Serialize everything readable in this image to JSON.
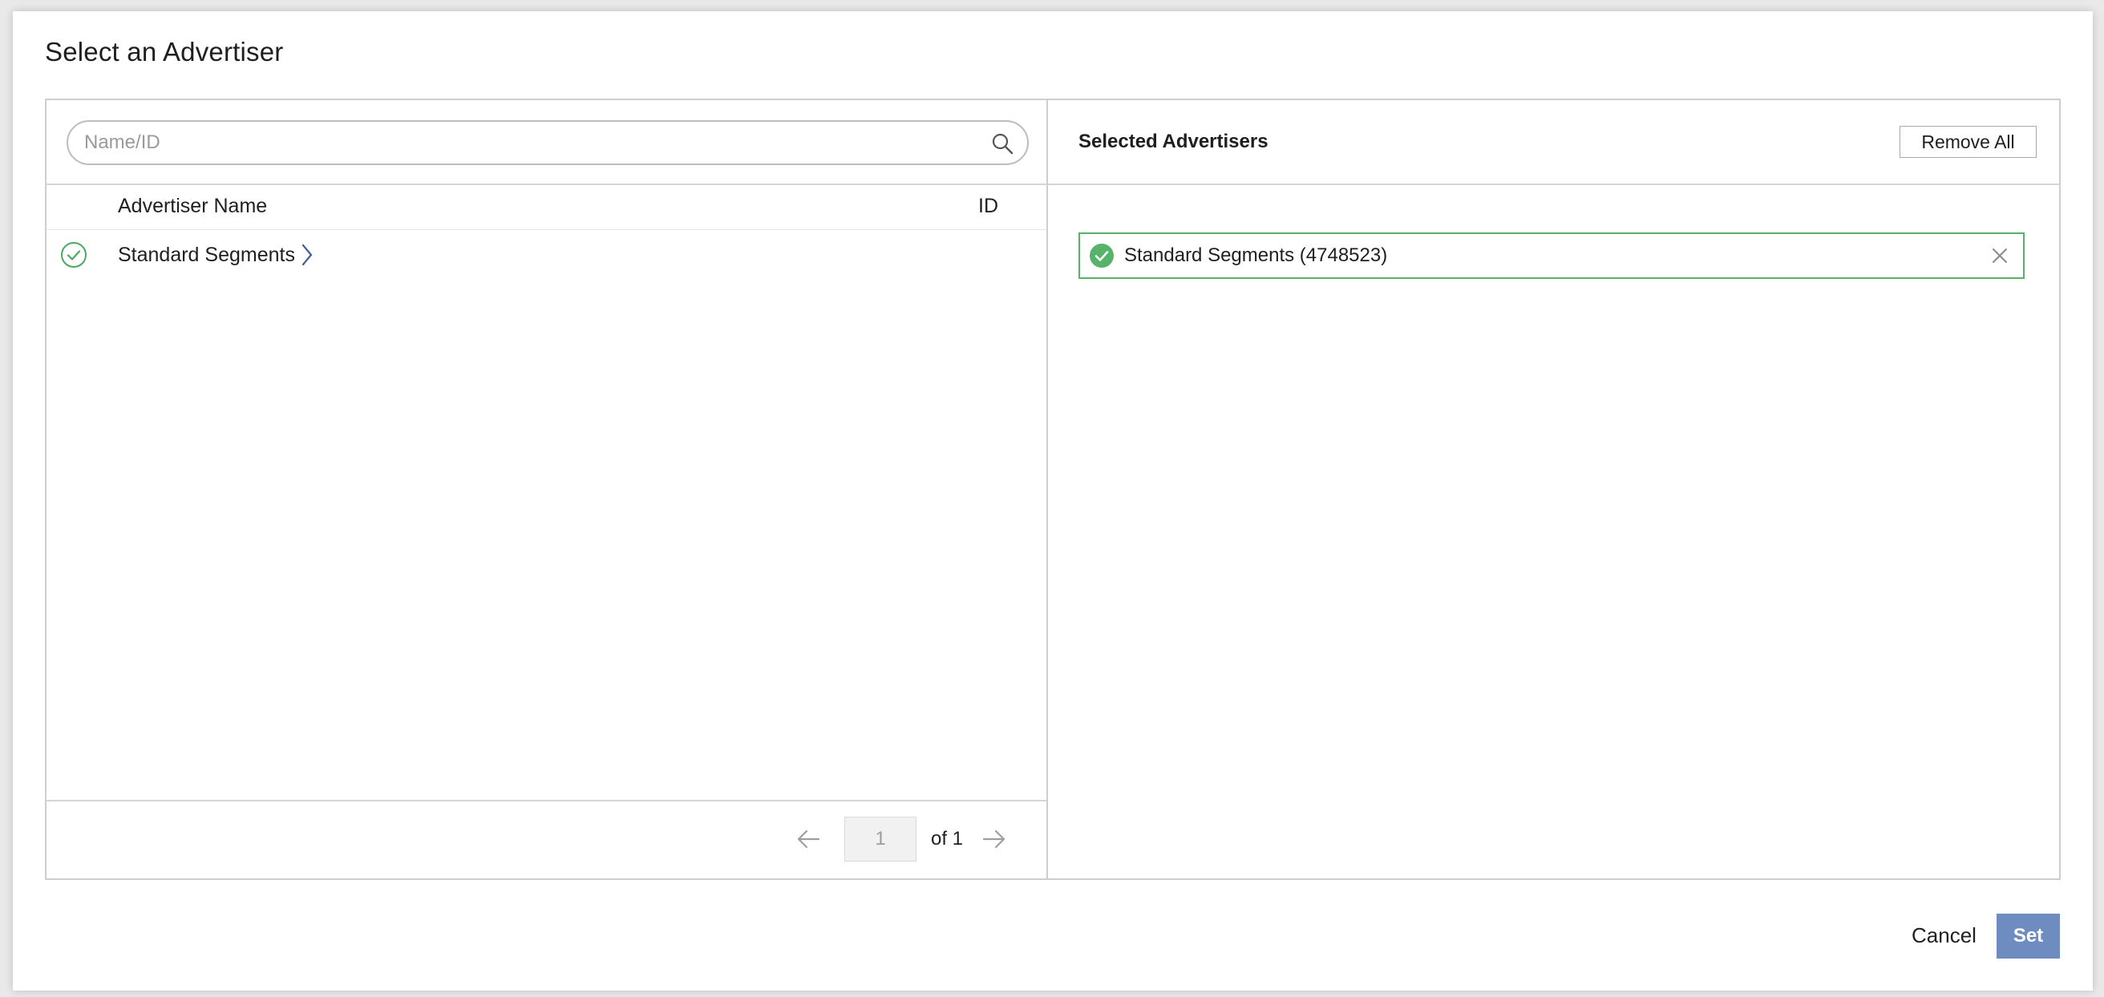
{
  "dialog": {
    "title": "Select an Advertiser"
  },
  "search": {
    "placeholder": "Name/ID",
    "value": "",
    "icon": "search-icon"
  },
  "table": {
    "columns": [
      "Advertiser Name",
      "ID"
    ],
    "rows": [
      {
        "name": "Standard Segments",
        "id": "",
        "selected": true,
        "icon": "check-circle-outline-icon",
        "expand_icon": "chevron-right-icon"
      }
    ]
  },
  "pagination": {
    "current_page": "1",
    "of_label": "of 1",
    "prev_icon": "arrow-left-icon",
    "next_icon": "arrow-right-icon"
  },
  "selected_panel": {
    "title": "Selected Advertisers",
    "remove_all_label": "Remove All",
    "items": [
      {
        "label": "Standard Segments (4748523)",
        "icon": "check-circle-filled-icon",
        "remove_icon": "close-icon"
      }
    ]
  },
  "footer": {
    "cancel_label": "Cancel",
    "set_label": "Set"
  },
  "colors": {
    "accent_green": "#57b26a",
    "primary_button": "#6f8cc1",
    "border": "#cfcfcf"
  }
}
